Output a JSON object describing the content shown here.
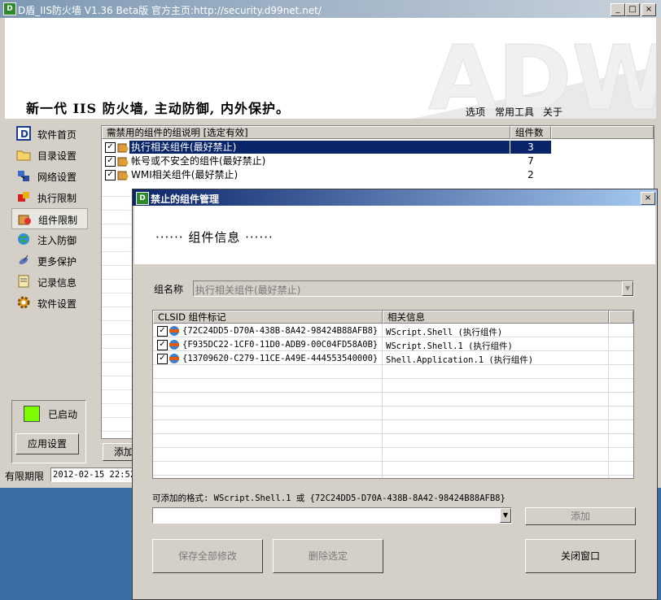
{
  "window": {
    "title": "D盾_IIS防火墙 V1.36 Beta版  官方主页:http://security.d99net.net/",
    "icon_text": "D",
    "min": "_",
    "max": "□",
    "close": "×"
  },
  "banner": {
    "slogan": "新一代 IIS 防火墙, 主动防御, 内外保护。",
    "logo_text": "ADW",
    "menu": [
      "选项",
      "常用工具",
      "关于"
    ]
  },
  "sidebar": {
    "items": [
      {
        "label": "软件首页",
        "icon": "d-logo-icon"
      },
      {
        "label": "目录设置",
        "icon": "folder-icon"
      },
      {
        "label": "网络设置",
        "icon": "network-icon"
      },
      {
        "label": "执行限制",
        "icon": "exec-icon"
      },
      {
        "label": "组件限制",
        "icon": "component-icon"
      },
      {
        "label": "注入防御",
        "icon": "globe-icon"
      },
      {
        "label": "更多保护",
        "icon": "satellite-icon"
      },
      {
        "label": "记录信息",
        "icon": "log-icon"
      },
      {
        "label": "软件设置",
        "icon": "gear-icon"
      }
    ],
    "active_index": 4,
    "status_label": "已启动",
    "status_color": "#7cfc00",
    "apply_label": "应用设置"
  },
  "component_table": {
    "headers": [
      "需禁用的组件的组说明 [选定有效]",
      "组件数"
    ],
    "rows": [
      {
        "name": "执行相关组件(最好禁止)",
        "count": "3",
        "checked": true,
        "selected": true
      },
      {
        "name": "帐号或不安全的组件(最好禁止)",
        "count": "7",
        "checked": true
      },
      {
        "name": "WMI相关组件(最好禁止)",
        "count": "2",
        "checked": true
      }
    ]
  },
  "add_button_partial": "添加",
  "statusbar": {
    "label": "有限期限",
    "value": "2012-02-15 22:52"
  },
  "dialog": {
    "title": "禁止的组件管理",
    "close": "×",
    "header": "······ 组件信息 ······",
    "group_label": "组名称",
    "group_value": "执行相关组件(最好禁止)",
    "list_headers": [
      "CLSID 组件标记",
      "相关信息"
    ],
    "list_rows": [
      {
        "clsid": "{72C24DD5-D70A-438B-8A42-98424B88AFB8}",
        "info": "WScript.Shell (执行组件)"
      },
      {
        "clsid": "{F935DC22-1CF0-11D0-ADB9-00C04FD58A0B}",
        "info": "WScript.Shell.1 (执行组件)"
      },
      {
        "clsid": "{13709620-C279-11CE-A49E-444553540000}",
        "info": "Shell.Application.1 (执行组件)"
      }
    ],
    "format_hint": "可添加的格式: WScript.Shell.1  或  {72C24DD5-D70A-438B-8A42-98424B88AFB8}",
    "add_input_value": "",
    "add_label": "添加",
    "save_all_label": "保存全部修改",
    "delete_label": "删除选定",
    "close_label": "关闭窗口"
  }
}
